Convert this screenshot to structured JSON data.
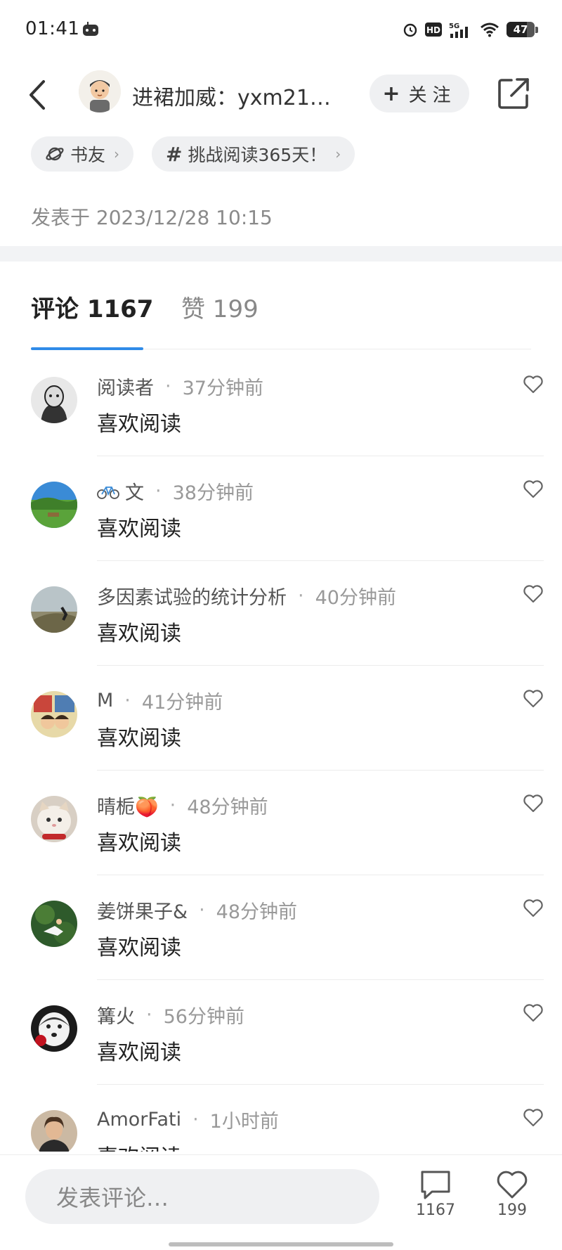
{
  "status_bar": {
    "time": "01:41",
    "battery": "47"
  },
  "header": {
    "title": "进裙加威：yxm21…",
    "follow_label": "关注",
    "follow_plus": "+"
  },
  "tags": [
    {
      "label": "书友",
      "icon": "planet-icon"
    },
    {
      "label": "挑战阅读365天！",
      "icon": "hash-icon"
    }
  ],
  "posted_time": "发表于 2023/12/28 10:15",
  "tabs": {
    "comments": "评论 1167",
    "likes": "赞 199"
  },
  "comments": [
    {
      "user": "阅读者",
      "time": "37分钟前",
      "text": "喜欢阅读"
    },
    {
      "user": "文",
      "user_prefix_icon": "bicycle-icon",
      "time": "38分钟前",
      "text": "喜欢阅读"
    },
    {
      "user": "多因素试验的统计分析",
      "time": "40分钟前",
      "text": "喜欢阅读"
    },
    {
      "user": "M",
      "time": "41分钟前",
      "text": "喜欢阅读"
    },
    {
      "user": "晴栀🍑",
      "time": "48分钟前",
      "text": "喜欢阅读"
    },
    {
      "user": "姜饼果子&",
      "time": "48分钟前",
      "text": "喜欢阅读"
    },
    {
      "user": "篝火",
      "time": "56分钟前",
      "text": "喜欢阅读"
    },
    {
      "user": "AmorFati",
      "time": "1小时前",
      "text": "喜欢阅读"
    }
  ],
  "bottom_bar": {
    "input_placeholder": "发表评论…",
    "comment_count": "1167",
    "like_count": "199"
  },
  "colors": {
    "accent": "#2f8be8",
    "chip_bg": "#eff0f2",
    "section_gap": "#f2f3f5"
  }
}
